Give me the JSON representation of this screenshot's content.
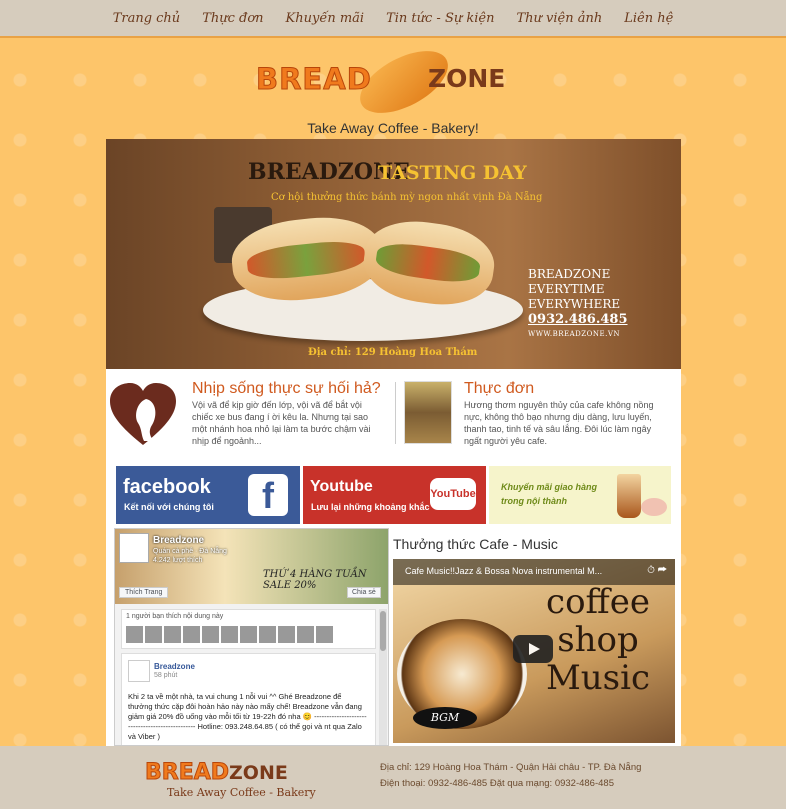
{
  "nav": {
    "items": [
      "Trang chủ",
      "Thực đơn",
      "Khuyến mãi",
      "Tin tức - Sự kiện",
      "Thư viện ảnh",
      "Liên hệ"
    ]
  },
  "logo": {
    "part1": "BREAD",
    "part2": "ZONE"
  },
  "tagline": "Take Away Coffee - Bakery!",
  "hero": {
    "title1": "BREADZONE",
    "title2": "TASTING DAY",
    "subtitle": "Cơ hội thưởng thức bánh mỳ ngon nhất vịnh Đà Nẵng",
    "side1": "BREADZONE",
    "side2": "EVERYTIME",
    "side3": "EVERYWHERE",
    "phone": "0932.486.485",
    "web": "WWW.BREADZONE.VN",
    "address": "Địa chỉ: 129 Hoàng Hoa Thám"
  },
  "intro": {
    "left": {
      "title": "Nhịp sống thực sự hối hả?",
      "text": "Vội vã để kịp giờ đến lớp, vội vã để bắt vội chiếc xe bus đang í ời kêu la. Nhưng tại sao một nhánh hoa nhỏ lại làm ta bước chậm vài nhịp để ngoảnh..."
    },
    "right": {
      "title": "Thực đơn",
      "text": "Hương thơm nguyên thủy của cafe không nồng nực, không thô bạo nhưng dịu dàng, lưu luyến, thanh tao, tinh tế và sâu lắng. Đôi lúc làm ngây ngất người yêu cafe."
    }
  },
  "banners": {
    "facebook": {
      "title": "facebook",
      "sub": "Kết nối với chúng tôi",
      "icon": "f"
    },
    "youtube": {
      "title": "Youtube",
      "sub": "Lưu lại những khoảng khắc",
      "icon": "YouTube"
    },
    "promo": {
      "text": "Khuyến mãi giao hàng trong nội thành"
    }
  },
  "fbwidget": {
    "page_name": "Breadzone",
    "category": "Quán cà phê · Đà Nẵng",
    "likes": "4.242 lượt thích",
    "cover_text": "THỨ 4 HÀNG TUẦN SALE 20%",
    "like_button": "Thích Trang",
    "share_button": "Chia sẻ",
    "friends_text": "1 người bạn thích nội dung này",
    "post_author": "Breadzone",
    "post_time": "58 phút",
    "post_body": "Khi 2 ta về một nhà, ta vui chung 1 nỗi vui ^^ Ghé Breadzone để thưởng thức cặp đôi hoàn hảo này nào mấy chế! Breadzone vẫn đang giảm giá 20% đồ uống vào mỗi tối từ 19-22h đó nha 😊 ------------------------------------------------ Hotline: 093.248.64.85 ( có thể gọi và nt qua Zalo và Viber )"
  },
  "video": {
    "heading": "Thưởng thức Cafe - Music",
    "title": "Cafe Music!!Jazz & Bossa Nova instrumental M...",
    "overlay_line1": "coffee",
    "overlay_line2": "shop",
    "overlay_line3": "Music",
    "badge": "BGM",
    "share_icon": "share-icon",
    "clock_icon": "clock-icon"
  },
  "footer": {
    "logo1": "BREAD",
    "logo2": "ZONE",
    "tagline": "Take Away Coffee - Bakery",
    "address": "Địa chỉ: 129 Hoàng Hoa Thám - Quận Hải châu - TP. Đà Nẵng",
    "phone": "Điện thoại: 0932-486-485 Đặt qua mạng: 0932-486-485"
  }
}
